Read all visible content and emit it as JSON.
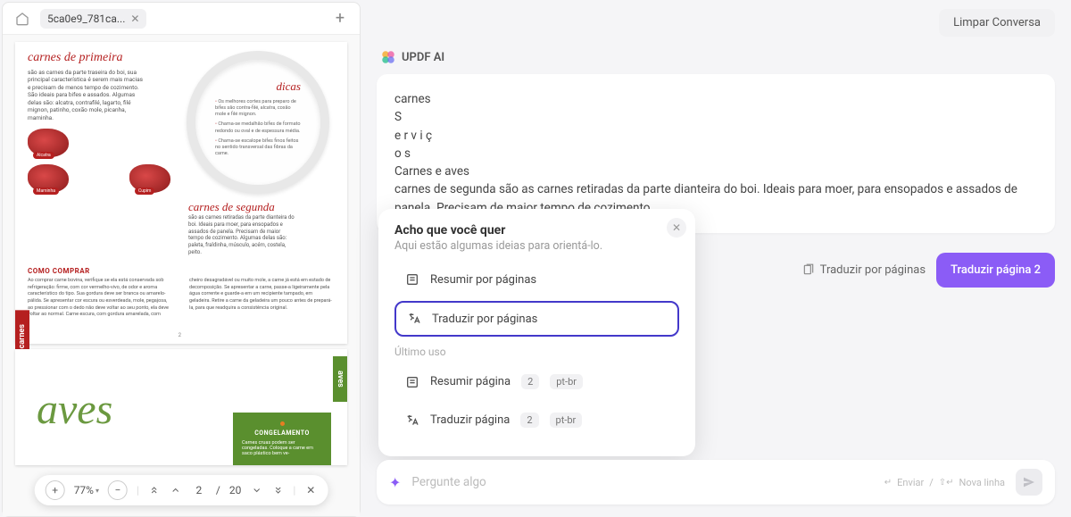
{
  "tabs": {
    "file_name": "5ca0e9_781ca..."
  },
  "pdf": {
    "page1": {
      "title_primeira": "carnes de primeira",
      "body_primeira": "são as carnes da parte traseira do boi, sua principal característica é serem mais macias e precisam de menos tempo de cozimento. São ideais para bifes e assados. Algumas delas são: alcatra, contrafilé, lagarto, filé mignon, patinho, coxão mole, picanha, maminha.",
      "dicas_title": "dicas",
      "tip1": "Os melhores cortes para preparo de bifes são contra-filé, alcatra, coxão mole e filé mignon.",
      "tip2": "Chama-se medalhão bifes de formato redondo ou oval e de espessura média.",
      "tip3": "Chama-se escalope bifes finos feitos no sentido transversal das fibras da carne.",
      "meat_labels": [
        "Alcatra",
        "Maminha",
        "Cupim"
      ],
      "title_segunda": "carnes de segunda",
      "body_segunda": "são as carnes retiradas da parte dianteira do boi. Ideais para moer, para ensopados e assados de panela. Precisam de maior tempo de cozimento. Algumas delas são: paleta, fraldinha, músculo, acém, costela, peito.",
      "comprar_title": "COMO COMPRAR",
      "comprar_col1": "Ao comprar carne bovina, verifique se ela está conservada sob refrigeração: firme, com cor vermelho-vivo, de odor e aroma característico do tipo. Sua gordura deve ser branca ou amarelo-pálida. Se apresentar cor escura ou esverdeada, mole, pegajosa, ao pressionar com o dedo não deve voltar ao seu ponto, ela deve voltar ao normal. Carne escura, com gordura amarelada, com",
      "comprar_col2": "cheiro desagradável ou muito mole, a carne já está em estado de decomposição. Se apresentar a carne, passe-a ligeiramente pela água corrente e guarde-a em um recipiente tampado, em geladeira. Retire a carne da geladeira um pouco antes de prepará-la, para que readquira a consistência original.",
      "page_num": "2"
    },
    "page2": {
      "aves_title": "aves",
      "aves_tab": "aves",
      "cong_title": "CONGELAMENTO",
      "cong_body": "Carnes cruas podem ser congeladas. Coloque a carne em saco plástico bem ve-"
    },
    "carnes_tab": "carnes"
  },
  "toolbar": {
    "zoom": "77%",
    "page_current": "2",
    "page_sep": "/",
    "page_total": "20"
  },
  "header": {
    "clear": "Limpar Conversa"
  },
  "ai": {
    "name": "UPDF AI"
  },
  "message": {
    "l1": "carnes",
    "l2": "S",
    "l3": "e r v i ç",
    "l4": "o s",
    "l5": "Carnes e aves",
    "l6": "carnes de segunda são as carnes retiradas da parte dianteira do boi. Ideais para moer, para ensopados e assados de panela. Precisam de maior tempo de cozimento"
  },
  "translate": {
    "label": "Traduzir por páginas",
    "button": "Traduzir página 2"
  },
  "suggest": {
    "title": "Acho que você quer",
    "subtitle": "Aqui estão algumas ideias para orientá-lo.",
    "opt1": "Resumir por páginas",
    "opt2": "Traduzir por páginas",
    "section": "Último uso",
    "recent1": "Resumir página",
    "recent2": "Traduzir página",
    "badge_page": "2",
    "badge_lang": "pt-br"
  },
  "input": {
    "placeholder": "Pergunte algo",
    "hint_send": "Enviar",
    "hint_sep": "/",
    "hint_newline": "Nova linha"
  }
}
